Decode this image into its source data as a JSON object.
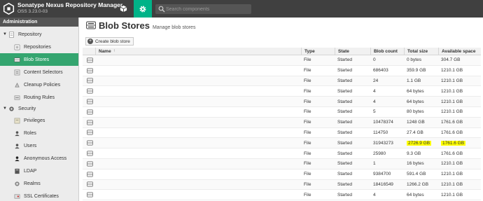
{
  "header": {
    "app_title": "Sonatype Nexus Repository Manager",
    "version": "OSS 3.23.0-03",
    "search_placeholder": "Search components"
  },
  "sidebar": {
    "header": "Administration",
    "items": [
      {
        "label": "Repository",
        "kind": "section",
        "icon": "database-icon"
      },
      {
        "label": "Repositories",
        "kind": "child",
        "icon": "repositories-icon"
      },
      {
        "label": "Blob Stores",
        "kind": "child",
        "icon": "blob-store-icon",
        "active": true
      },
      {
        "label": "Content Selectors",
        "kind": "child",
        "icon": "content-selector-icon"
      },
      {
        "label": "Cleanup Policies",
        "kind": "child",
        "icon": "cleanup-icon"
      },
      {
        "label": "Routing Rules",
        "kind": "child",
        "icon": "routing-icon"
      },
      {
        "label": "Security",
        "kind": "section",
        "icon": "gear-icon"
      },
      {
        "label": "Privileges",
        "kind": "child",
        "icon": "privileges-icon"
      },
      {
        "label": "Roles",
        "kind": "child",
        "icon": "roles-icon"
      },
      {
        "label": "Users",
        "kind": "child",
        "icon": "users-icon"
      },
      {
        "label": "Anonymous Access",
        "kind": "child",
        "icon": "anonymous-icon"
      },
      {
        "label": "LDAP",
        "kind": "child",
        "icon": "ldap-icon"
      },
      {
        "label": "Realms",
        "kind": "child",
        "icon": "realms-icon"
      },
      {
        "label": "SSL Certificates",
        "kind": "child",
        "icon": "ssl-icon"
      }
    ]
  },
  "main": {
    "title": "Blob Stores",
    "subtitle": "Manage blob stores",
    "create_button": "Create blob store",
    "columns": {
      "name": "Name",
      "type": "Type",
      "state": "State",
      "count": "Blob count",
      "size": "Total size",
      "avail": "Available space"
    },
    "rows": [
      {
        "type": "File",
        "state": "Started",
        "count": "0",
        "size": "0 bytes",
        "avail": "304.7 GB"
      },
      {
        "type": "File",
        "state": "Started",
        "count": "686403",
        "size": "359.9 GB",
        "avail": "1210.1 GB"
      },
      {
        "type": "File",
        "state": "Started",
        "count": "24",
        "size": "1.1 GB",
        "avail": "1210.1 GB"
      },
      {
        "type": "File",
        "state": "Started",
        "count": "4",
        "size": "64 bytes",
        "avail": "1210.1 GB"
      },
      {
        "type": "File",
        "state": "Started",
        "count": "4",
        "size": "64 bytes",
        "avail": "1210.1 GB"
      },
      {
        "type": "File",
        "state": "Started",
        "count": "5",
        "size": "80 bytes",
        "avail": "1210.1 GB"
      },
      {
        "type": "File",
        "state": "Started",
        "count": "10478374",
        "size": "1248 GB",
        "avail": "1761.6 GB"
      },
      {
        "type": "File",
        "state": "Started",
        "count": "114750",
        "size": "27.4 GB",
        "avail": "1761.6 GB"
      },
      {
        "type": "File",
        "state": "Started",
        "count": "31943273",
        "size": "2726.9 GB",
        "avail": "1761.6 GB",
        "highlight": true
      },
      {
        "type": "File",
        "state": "Started",
        "count": "25980",
        "size": "9.3 GB",
        "avail": "1761.6 GB"
      },
      {
        "type": "File",
        "state": "Started",
        "count": "1",
        "size": "16 bytes",
        "avail": "1210.1 GB"
      },
      {
        "type": "File",
        "state": "Started",
        "count": "9384700",
        "size": "591.4 GB",
        "avail": "1210.1 GB"
      },
      {
        "type": "File",
        "state": "Started",
        "count": "18416549",
        "size": "1266.2 GB",
        "avail": "1210.1 GB"
      },
      {
        "type": "File",
        "state": "Started",
        "count": "4",
        "size": "64 bytes",
        "avail": "1210.1 GB"
      }
    ]
  },
  "colors": {
    "topbar": "#404040",
    "accent": "#00b388",
    "active_item": "#34a56f",
    "highlight": "#ffff00"
  }
}
